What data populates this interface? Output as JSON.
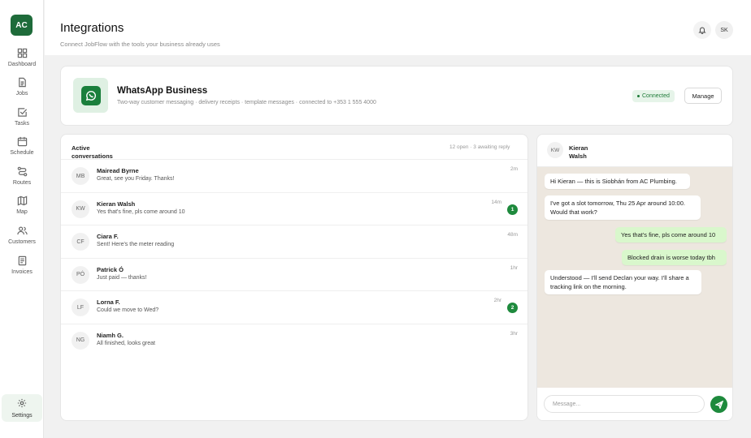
{
  "brand": {
    "logo_text": "AC",
    "accent": "#1e6b3a"
  },
  "sidebar": {
    "items": [
      {
        "label": "Dashboard",
        "icon": "grid-icon"
      },
      {
        "label": "Jobs",
        "icon": "document-icon"
      },
      {
        "label": "Tasks",
        "icon": "checkbox-icon"
      },
      {
        "label": "Schedule",
        "icon": "calendar-icon"
      },
      {
        "label": "Routes",
        "icon": "route-icon"
      },
      {
        "label": "Map",
        "icon": "map-icon"
      },
      {
        "label": "Customers",
        "icon": "users-icon"
      },
      {
        "label": "Invoices",
        "icon": "invoice-icon"
      }
    ],
    "settings": {
      "label": "Settings",
      "icon": "gear-icon"
    }
  },
  "header": {
    "title": "Integrations",
    "subtitle": "Connect JobFlow with the tools your business already uses",
    "user_initials": "SK",
    "bell_icon": "bell-icon"
  },
  "integration": {
    "name": "WhatsApp Business",
    "description": "Two-way customer messaging · delivery receipts · template messages · connected to +353 1 555 4000",
    "status": "Connected",
    "status_color": "#1e7a38",
    "manage_label": "Manage",
    "icon": "whatsapp-icon"
  },
  "conversations": {
    "title": "Active conversations",
    "summary": "12 open · 3 awaiting reply",
    "items": [
      {
        "initials": "MB",
        "name": "Mairead Byrne",
        "preview": "Great, see you Friday. Thanks!",
        "time": "2m",
        "unread": ""
      },
      {
        "initials": "KW",
        "name": "Kieran Walsh",
        "preview": "Yes that's fine, pls come around 10",
        "time": "14m",
        "unread": "1"
      },
      {
        "initials": "CF",
        "name": "Ciara F.",
        "preview": "Sent! Here's the meter reading",
        "time": "48m",
        "unread": ""
      },
      {
        "initials": "PÓ",
        "name": "Patrick Ó",
        "preview": "Just paid — thanks!",
        "time": "1hr",
        "unread": ""
      },
      {
        "initials": "LF",
        "name": "Lorna F.",
        "preview": "Could we move to Wed?",
        "time": "2hr",
        "unread": "2"
      },
      {
        "initials": "NG",
        "name": "Niamh G.",
        "preview": "All finished, looks great",
        "time": "3hr",
        "unread": ""
      }
    ]
  },
  "chat": {
    "initials": "KW",
    "name": "Kieran Walsh",
    "messages": [
      {
        "dir": "in",
        "text": "Hi Kieran — this is Siobhán from AC Plumbing."
      },
      {
        "dir": "in",
        "text": "I've got a slot tomorrow, Thu 25 Apr around 10:00. Would that work?"
      },
      {
        "dir": "out",
        "text": "Yes that's fine, pls come around 10"
      },
      {
        "dir": "out",
        "text": "Blocked drain is worse today tbh"
      },
      {
        "dir": "in",
        "text": "Understood — I'll send Declan your way. I'll share a tracking link on the morning."
      }
    ],
    "input_placeholder": "Message...",
    "send_icon": "send-icon"
  }
}
